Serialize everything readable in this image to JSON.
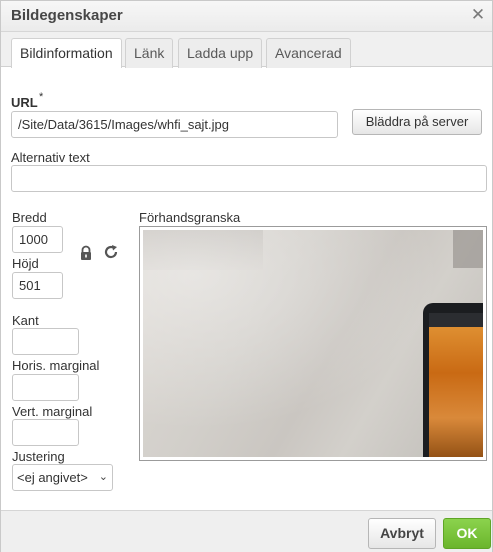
{
  "dialog": {
    "title": "Bildegenskaper",
    "close_icon": "close-icon"
  },
  "tabs": [
    {
      "label": "Bildinformation",
      "active": true
    },
    {
      "label": "Länk",
      "active": false
    },
    {
      "label": "Ladda upp",
      "active": false
    },
    {
      "label": "Avancerad",
      "active": false
    }
  ],
  "url": {
    "label": "URL",
    "required_mark": "*",
    "value": "/Site/Data/3615/Images/whfi_sajt.jpg",
    "browse_button": "Bläddra på server"
  },
  "alt": {
    "label": "Alternativ text",
    "value": ""
  },
  "size": {
    "width_label": "Bredd",
    "width_value": "1000",
    "height_label": "Höjd",
    "height_value": "501",
    "lock_icon": "lock-icon",
    "reset_icon": "reset-size-icon"
  },
  "border": {
    "label": "Kant",
    "value": ""
  },
  "hspace": {
    "label": "Horis. marginal",
    "value": ""
  },
  "vspace": {
    "label": "Vert. marginal",
    "value": ""
  },
  "align": {
    "label": "Justering",
    "selected": "<ej angivet>"
  },
  "preview": {
    "label": "Förhandsgranska"
  },
  "footer": {
    "cancel": "Avbryt",
    "ok": "OK"
  },
  "colors": {
    "ok_green": "#75bd34",
    "title_text": "#474747"
  }
}
